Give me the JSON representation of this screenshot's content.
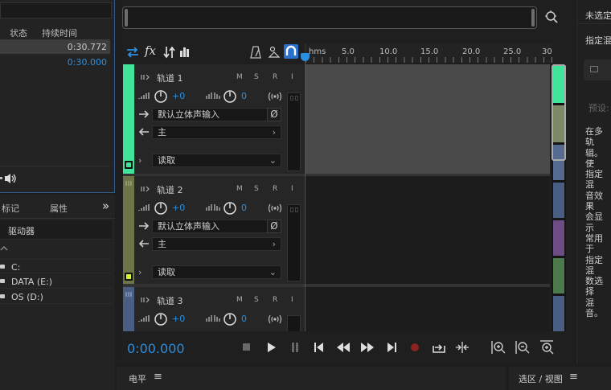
{
  "files_panel": {
    "col_status": "状态",
    "col_duration": "持续时间",
    "rows": [
      {
        "duration": "0:30.772"
      },
      {
        "duration": "0:30.000"
      }
    ]
  },
  "left_bottom": {
    "tab_markers": "标记",
    "tab_properties": "属性",
    "expand": "»",
    "drive_header": "驱动器",
    "drives": [
      "C:",
      "DATA (E:)",
      "OS (D:)"
    ]
  },
  "ruler": {
    "unit": "hms",
    "ticks": [
      "5.0",
      "10.0",
      "15.0",
      "20.0",
      "25.0",
      "30"
    ]
  },
  "tracks": [
    {
      "name": "轨道 1",
      "volume": "+0",
      "pan": "0",
      "input": "默认立体声输入",
      "output": "主",
      "automation": "读取",
      "color": "#3fe39a"
    },
    {
      "name": "轨道 2",
      "volume": "+0",
      "pan": "0",
      "input": "默认立体声输入",
      "output": "主",
      "automation": "读取",
      "color": "#6b7549"
    },
    {
      "name": "轨道 3",
      "volume": "+0",
      "pan": "0",
      "color": "#4a5d82"
    }
  ],
  "track_buttons": {
    "mute": "M",
    "solo": "S",
    "record": "R",
    "input_monitor": "I"
  },
  "transport": {
    "time": "0:00.000"
  },
  "bottom_panels": {
    "levels": "电平",
    "selection_view": "选区 / 视图"
  },
  "right_panel": {
    "title": "未选定",
    "label": "指定混",
    "preset_label": "预设:",
    "description_lines": [
      "在多轨",
      "辑。使",
      "指定混",
      "音效果",
      "会显示",
      "常用于",
      "指定混",
      "数选择",
      "混音。"
    ]
  },
  "colors": {
    "accent": "#2a8fe0",
    "track1": "#3fe39a",
    "track2": "#6b7549",
    "track3": "#4a5d82",
    "playhead": "#c0272d"
  }
}
